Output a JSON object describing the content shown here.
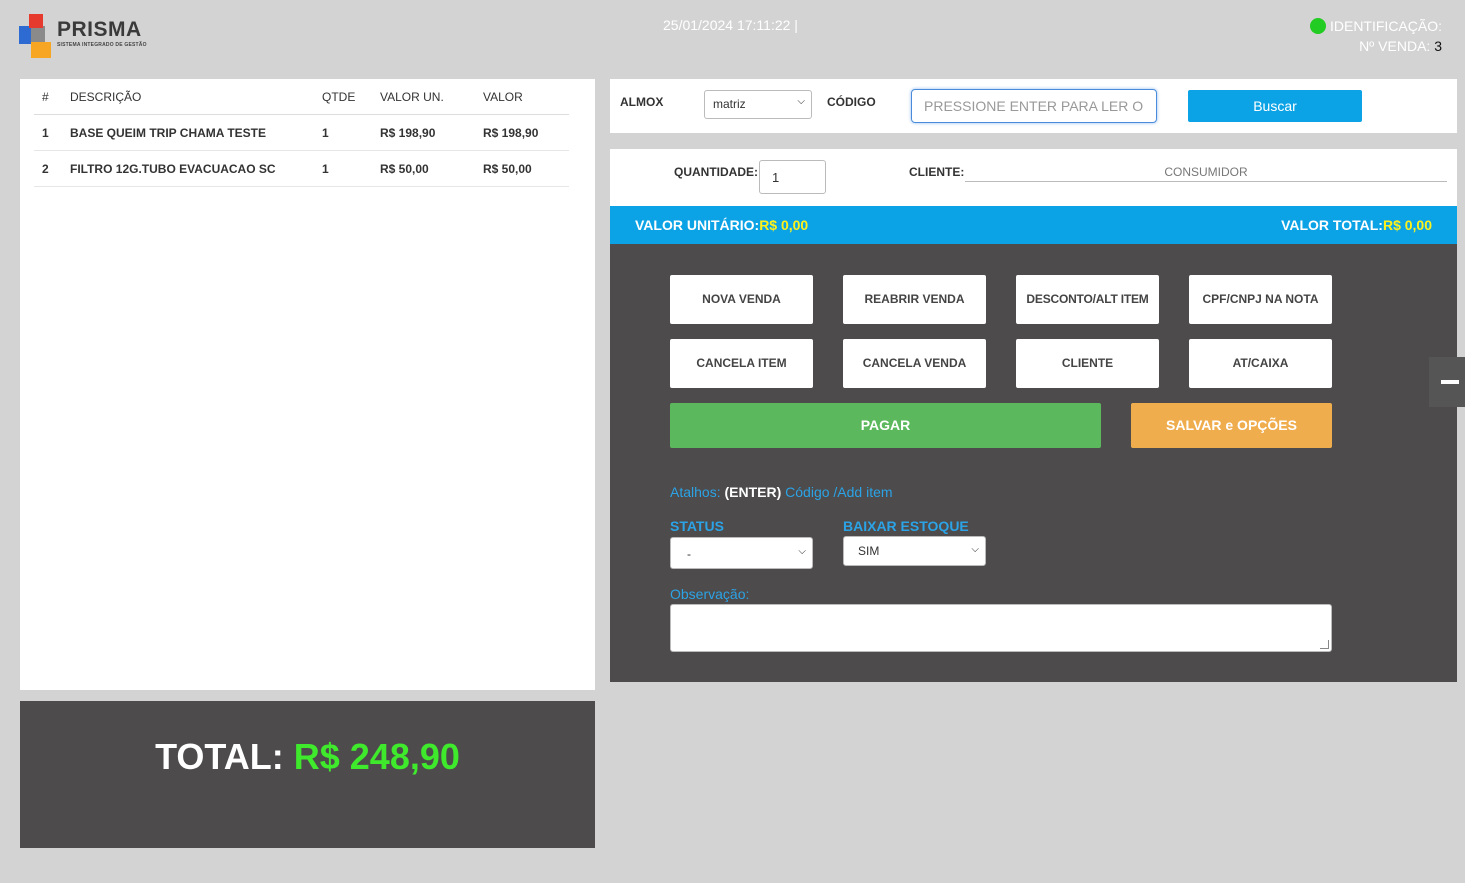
{
  "header": {
    "logo_word": "PRISMA",
    "logo_sub": "SISTEMA INTEGRADO DE GESTÃO",
    "datetime": "25/01/2024 17:11:22 |",
    "ident_label": "IDENTIFICAÇÃO:",
    "sale_label": "Nº VENDA:",
    "sale_number": "3",
    "status_color": "#22cc22"
  },
  "items": {
    "headers": [
      "#",
      "DESCRIÇÃO",
      "QTDE",
      "VALOR UN.",
      "VALOR"
    ],
    "rows": [
      [
        "1",
        "BASE QUEIM TRIP CHAMA TESTE",
        "1",
        "R$ 198,90",
        "R$ 198,90"
      ],
      [
        "2",
        "FILTRO 12G.TUBO EVACUACAO SC",
        "1",
        "R$ 50,00",
        "R$ 50,00"
      ]
    ]
  },
  "total": {
    "label": "TOTAL:",
    "value": "R$ 248,90"
  },
  "search": {
    "almox_label": "ALMOX",
    "almox_value": "matriz",
    "codigo_label": "CÓDIGO",
    "codigo_placeholder": "PRESSIONE ENTER PARA LER O",
    "buscar_label": "Buscar"
  },
  "client": {
    "quantity_label": "QUANTIDADE:",
    "quantity_value": "1",
    "cliente_label": "CLIENTE:",
    "cliente_value": "CONSUMIDOR"
  },
  "values": {
    "unit_label": "VALOR UNITÁRIO:",
    "unit_value": "R$ 0,00",
    "total_label": "VALOR TOTAL:",
    "total_value": "R$ 0,00"
  },
  "actions": {
    "nova_venda": "NOVA VENDA",
    "reabrir_venda": "REABRIR VENDA",
    "desconto": "DESCONTO/ALT ITEM",
    "cpf_nota": "CPF/CNPJ NA NOTA",
    "cancela_item": "CANCELA ITEM",
    "cancela_venda": "CANCELA VENDA",
    "cliente": "CLIENTE",
    "at_caixa": "AT/CAIXA",
    "pagar": "PAGAR",
    "salvar": "SALVAR e OPÇÕES"
  },
  "shortcuts": {
    "prefix": "Atalhos:",
    "key": "(ENTER)",
    "desc": "Código /Add item"
  },
  "status": {
    "label": "STATUS",
    "value": "-"
  },
  "baixar": {
    "label": "BAIXAR ESTOQUE",
    "value": "SIM"
  },
  "observacao": {
    "label": "Observação:"
  }
}
